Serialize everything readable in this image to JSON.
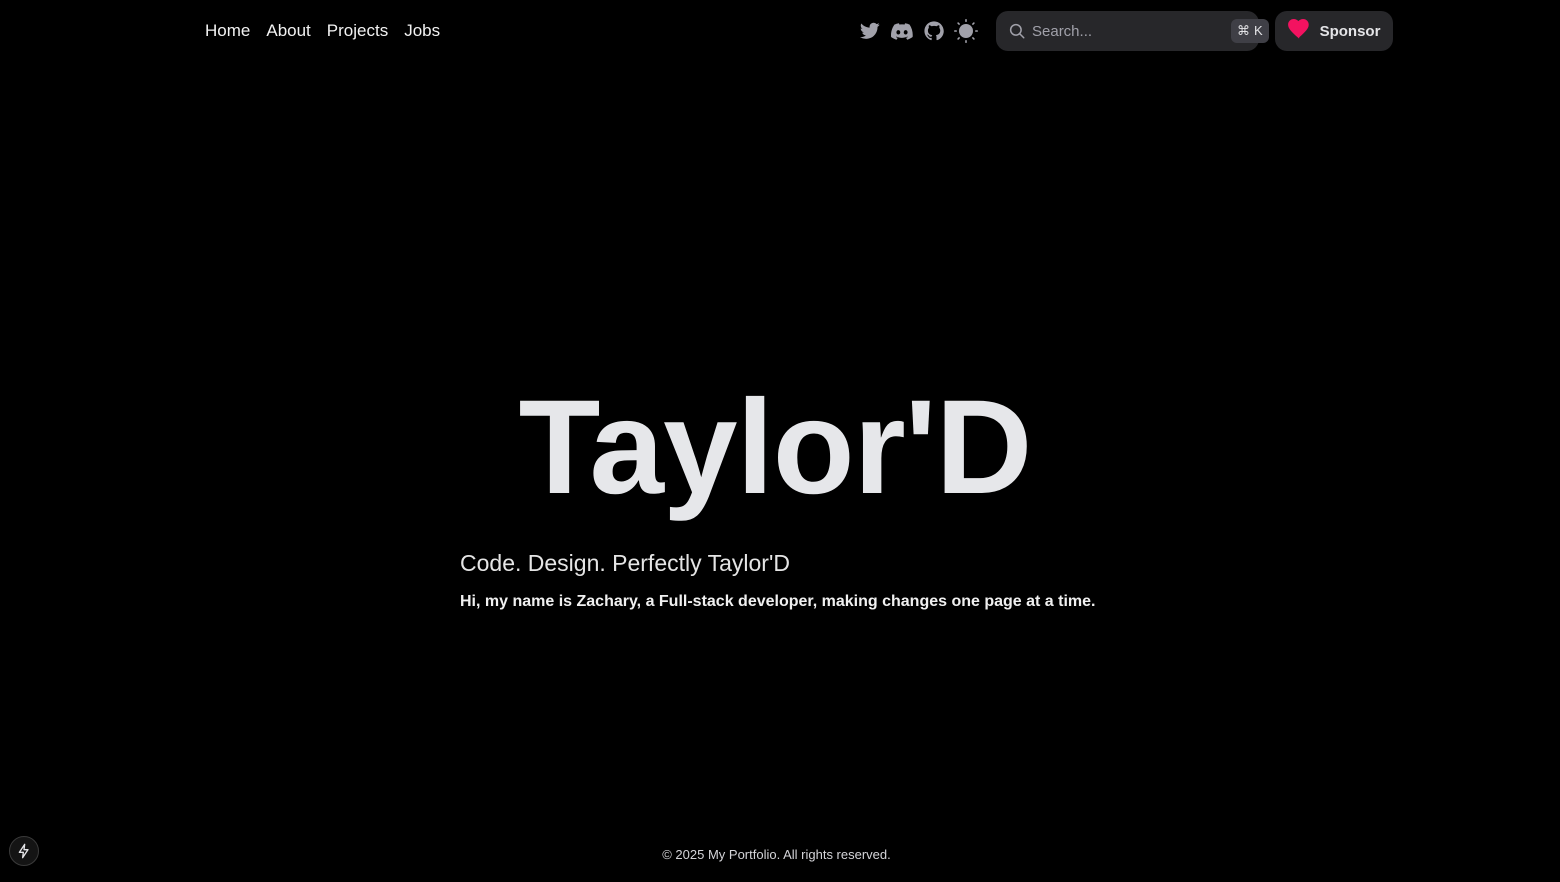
{
  "nav": {
    "links": [
      {
        "label": "Home"
      },
      {
        "label": "About"
      },
      {
        "label": "Projects"
      },
      {
        "label": "Jobs"
      }
    ],
    "icons": [
      "twitter-icon",
      "discord-icon",
      "github-icon",
      "sun-icon"
    ]
  },
  "search": {
    "placeholder": "Search...",
    "shortcut_symbol": "⌘",
    "shortcut_key": "K"
  },
  "sponsor": {
    "label": "Sponsor",
    "icon": "heart-icon",
    "icon_color": "#f31260"
  },
  "hero": {
    "title": "Taylor'D",
    "subtitle": "Code. Design. Perfectly Taylor'D",
    "description": "Hi, my name is Zachary, a Full-stack developer, making changes one page at a time."
  },
  "footer": {
    "text": "© 2025 My Portfolio. All rights reserved."
  },
  "colors": {
    "background": "#000000",
    "surface": "#27272a",
    "accent": "#f31260",
    "text": "#ececee"
  }
}
